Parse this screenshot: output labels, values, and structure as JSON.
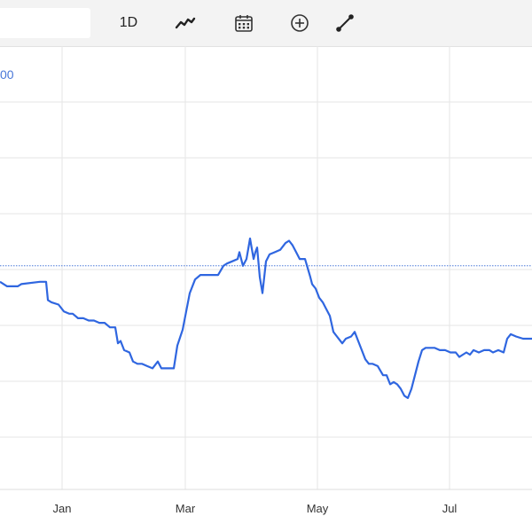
{
  "toolbar": {
    "search_value": "",
    "range_label": "1D",
    "icons": [
      "line-chart-icon",
      "calendar-icon",
      "add-circle-icon",
      "draw-line-icon"
    ]
  },
  "reference_line": {
    "label": "00",
    "color": "#4a78d8"
  },
  "chart_data": {
    "type": "line",
    "title": "",
    "xlabel": "",
    "ylabel": "",
    "x_ticks": [
      "Jan",
      "Mar",
      "May",
      "Jul"
    ],
    "grid": true,
    "line_color": "#2f66e0",
    "reference_value": 0.6,
    "ylim": [
      0,
      1
    ],
    "series": [
      {
        "name": "",
        "x": [
          0,
          8,
          20,
          24,
          45,
          52,
          54,
          58,
          66,
          72,
          78,
          82,
          88,
          94,
          100,
          106,
          112,
          118,
          124,
          130,
          133,
          136,
          140,
          146,
          150,
          155,
          160,
          166,
          172,
          178,
          182,
          186,
          190,
          196,
          200,
          206,
          210,
          214,
          220,
          226,
          232,
          238,
          246,
          252,
          256,
          262,
          268,
          270,
          274,
          278,
          282,
          286,
          288,
          290,
          293,
          296,
          300,
          304,
          310,
          316,
          322,
          326,
          330,
          334,
          338,
          344,
          350,
          352,
          356,
          360,
          364,
          368,
          372,
          376,
          380,
          386,
          390,
          396,
          400,
          404,
          408,
          412,
          416,
          420,
          426,
          432,
          436,
          440,
          444,
          448,
          452,
          456,
          460,
          464,
          468,
          472,
          476,
          480,
          484,
          490,
          496,
          502,
          508,
          514,
          518,
          522,
          526,
          530,
          534,
          540,
          546,
          552,
          556,
          562,
          568,
          572,
          576,
          582,
          590,
          596,
          600
        ],
        "values": [
          0.53,
          0.51,
          0.51,
          0.52,
          0.53,
          0.53,
          0.45,
          0.44,
          0.43,
          0.4,
          0.39,
          0.39,
          0.37,
          0.37,
          0.36,
          0.36,
          0.35,
          0.35,
          0.33,
          0.33,
          0.26,
          0.27,
          0.23,
          0.22,
          0.18,
          0.17,
          0.17,
          0.16,
          0.15,
          0.18,
          0.15,
          0.15,
          0.15,
          0.15,
          0.25,
          0.32,
          0.4,
          0.48,
          0.54,
          0.56,
          0.56,
          0.56,
          0.56,
          0.6,
          0.61,
          0.62,
          0.63,
          0.66,
          0.6,
          0.63,
          0.72,
          0.63,
          0.66,
          0.68,
          0.55,
          0.48,
          0.62,
          0.65,
          0.66,
          0.67,
          0.7,
          0.71,
          0.69,
          0.66,
          0.63,
          0.63,
          0.55,
          0.52,
          0.5,
          0.46,
          0.44,
          0.41,
          0.38,
          0.31,
          0.29,
          0.26,
          0.28,
          0.29,
          0.31,
          0.27,
          0.23,
          0.19,
          0.17,
          0.17,
          0.16,
          0.12,
          0.12,
          0.08,
          0.09,
          0.08,
          0.06,
          0.03,
          0.02,
          0.06,
          0.12,
          0.18,
          0.23,
          0.24,
          0.24,
          0.24,
          0.23,
          0.23,
          0.22,
          0.22,
          0.2,
          0.21,
          0.22,
          0.21,
          0.23,
          0.22,
          0.23,
          0.23,
          0.22,
          0.23,
          0.22,
          0.28,
          0.3,
          0.29,
          0.28,
          0.28,
          0.28
        ]
      }
    ]
  }
}
